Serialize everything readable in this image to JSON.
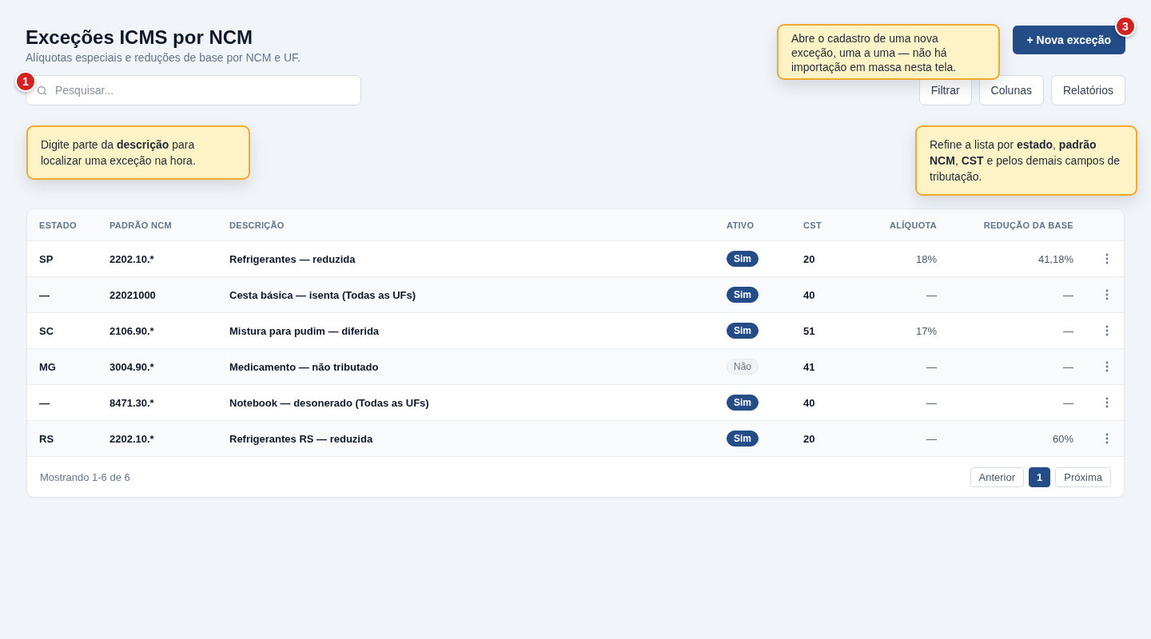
{
  "header": {
    "title": "Exceções ICMS por NCM",
    "subtitle": "Alíquotas especiais e reduções de base por NCM e UF.",
    "primary_button": "+ Nova exceção"
  },
  "search": {
    "placeholder": "Pesquisar..."
  },
  "toolbar_buttons": [
    "Filtrar",
    "Colunas",
    "Relatórios"
  ],
  "callouts": [
    {
      "step": "1",
      "text": "Digite parte da **descrição** para localizar uma exceção na hora."
    },
    {
      "step": "3",
      "text": "Abre o cadastro de uma nova exceção, uma a uma — não há importação em massa nesta tela."
    },
    {
      "text": "Refine a lista por **estado**, **padrão NCM**, **CST** e pelos demais campos de tributação."
    }
  ],
  "table": {
    "columns": [
      "ESTADO",
      "PADRÃO NCM",
      "DESCRIÇÃO",
      "ATIVO",
      "CST",
      "ALÍQUOTA",
      "REDUÇÃO DA BASE"
    ],
    "rows": [
      {
        "estado": "SP",
        "ncm": "2202.10.*",
        "descricao": "Refrigerantes — reduzida",
        "ativo": "Sim",
        "active": true,
        "cst": "20",
        "aliquota": "18%",
        "reducao": "41,18%"
      },
      {
        "estado": "—",
        "ncm": "22021000",
        "descricao": "Cesta básica — isenta (Todas as UFs)",
        "ativo": "Sim",
        "active": true,
        "cst": "40",
        "aliquota": "—",
        "reducao": "—"
      },
      {
        "estado": "SC",
        "ncm": "2106.90.*",
        "descricao": "Mistura para pudim — diferida",
        "ativo": "Sim",
        "active": true,
        "cst": "51",
        "aliquota": "17%",
        "reducao": "—"
      },
      {
        "estado": "MG",
        "ncm": "3004.90.*",
        "descricao": "Medicamento — não tributado",
        "ativo": "Não",
        "active": false,
        "cst": "41",
        "aliquota": "—",
        "reducao": "—"
      },
      {
        "estado": "—",
        "ncm": "8471.30.*",
        "descricao": "Notebook — desonerado (Todas as UFs)",
        "ativo": "Sim",
        "active": true,
        "cst": "40",
        "aliquota": "—",
        "reducao": "—"
      },
      {
        "estado": "RS",
        "ncm": "2202.10.*",
        "descricao": "Refrigerantes RS — reduzida",
        "ativo": "Sim",
        "active": true,
        "cst": "20",
        "aliquota": "—",
        "reducao": "60%"
      }
    ]
  },
  "footer": {
    "summary": "Mostrando 1-6 de 6",
    "pages": [
      {
        "label": "Anterior",
        "kind": "nav"
      },
      {
        "label": "1",
        "kind": "page",
        "selected": true
      },
      {
        "label": "Próxima",
        "kind": "nav"
      }
    ]
  }
}
